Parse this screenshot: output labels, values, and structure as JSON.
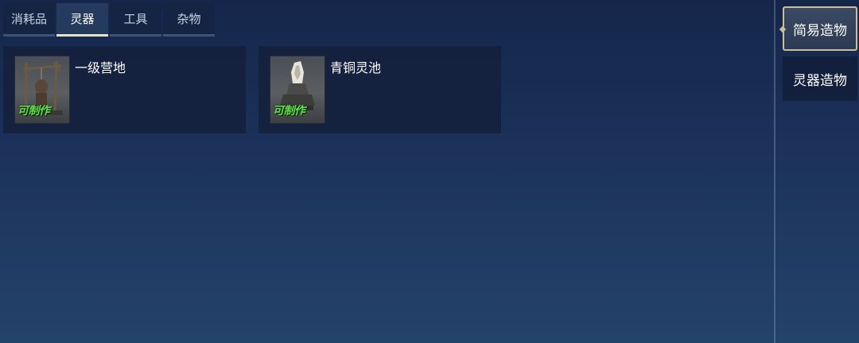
{
  "tabs": [
    {
      "label": "消耗品"
    },
    {
      "label": "灵器"
    },
    {
      "label": "工具"
    },
    {
      "label": "杂物"
    }
  ],
  "active_tab": "灵器",
  "items": [
    {
      "name": "一级营地",
      "status": "可制作",
      "icon": "camp-structure-icon"
    },
    {
      "name": "青铜灵池",
      "status": "可制作",
      "icon": "bronze-spirit-pool-icon"
    }
  ],
  "side_categories": [
    {
      "label": "简易造物"
    },
    {
      "label": "灵器造物"
    }
  ],
  "active_side_category": "简易造物",
  "colors": {
    "craftable_green": "#5fe24a",
    "active_border": "#c9bf9a"
  }
}
